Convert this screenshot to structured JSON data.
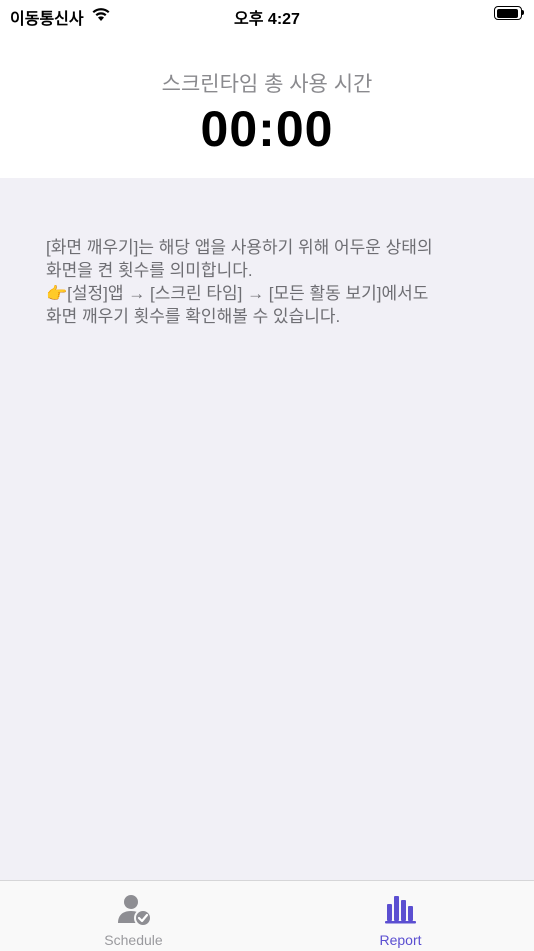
{
  "status_bar": {
    "carrier": "이동통신사",
    "time": "오후 4:27"
  },
  "header": {
    "title": "스크린타임 총 사용 시간",
    "total_time": "00:00"
  },
  "info": {
    "line1": "[화면 깨우기]는 해당 앱을 사용하기 위해 어두운 상태의",
    "line2": "화면을 켠 횟수를 의미합니다.",
    "line3": "👉[설정]앱 → [스크린 타임] → [모든 활동 보기]에서도",
    "line4": "화면 깨우기 횟수를 확인해볼 수 있습니다."
  },
  "tab_bar": {
    "tabs": [
      {
        "label": "Schedule",
        "icon": "person-check-icon",
        "selected": false
      },
      {
        "label": "Report",
        "icon": "bar-chart-icon",
        "selected": true
      }
    ],
    "accent_color": "#5b4fd1",
    "inactive_color": "#9a9a9e"
  }
}
